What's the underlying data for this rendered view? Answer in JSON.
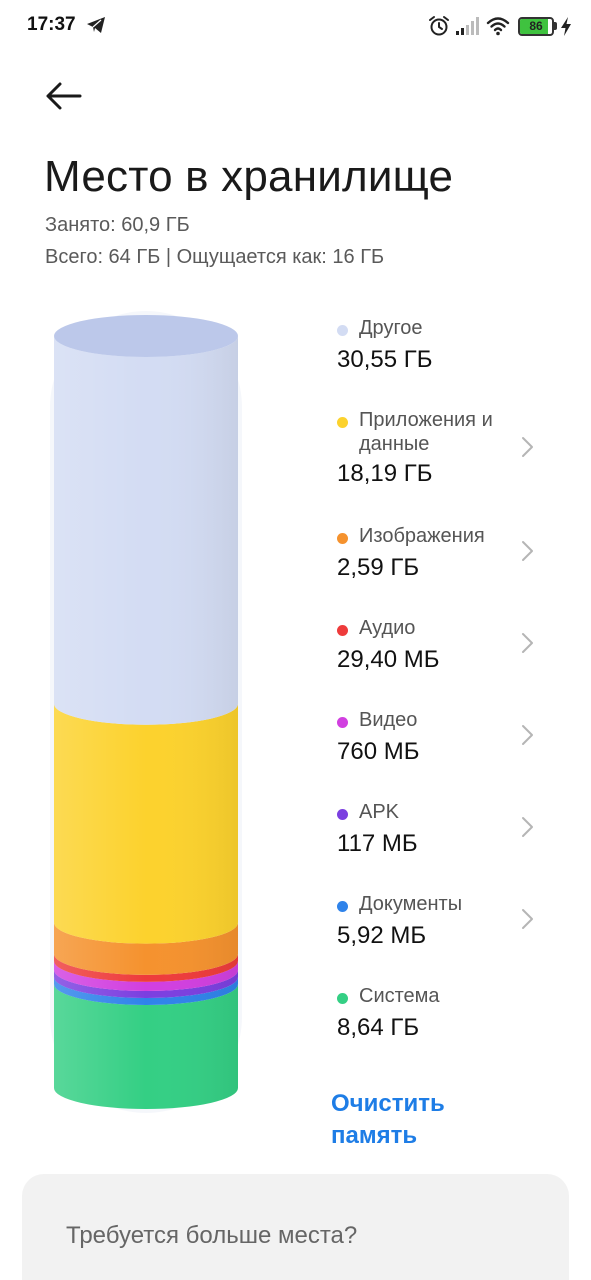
{
  "status_bar": {
    "time": "17:37",
    "battery_level": "86",
    "battery_fraction": 0.86,
    "icons": [
      "telegram-icon",
      "alarm-icon",
      "signal-icon",
      "wifi-icon",
      "battery-icon",
      "charging-icon"
    ]
  },
  "header": {
    "title": "Место в хранилище",
    "used": "Занято: 60,9 ГБ",
    "total": "Всего: 64 ГБ | Ощущается как: 16 ГБ"
  },
  "chart_data": {
    "type": "bar",
    "categories": [
      "Другое",
      "Приложения и данные",
      "Изображения",
      "Аудио",
      "Видео",
      "APK",
      "Документы",
      "Система"
    ],
    "values_gb": [
      30.55,
      18.19,
      2.59,
      0.0294,
      0.76,
      0.117,
      0.00592,
      8.64
    ]
  },
  "legend": [
    {
      "name": "Другое",
      "size": "30,55 ГБ",
      "color": "#d3dcf3",
      "chevron": false
    },
    {
      "name": "Приложения и данные",
      "size": "18,19 ГБ",
      "color": "#fcd22d",
      "chevron": true
    },
    {
      "name": "Изображения",
      "size": "2,59 ГБ",
      "color": "#f5922e",
      "chevron": true
    },
    {
      "name": "Аудио",
      "size": "29,40 МБ",
      "color": "#ee3b3b",
      "chevron": true
    },
    {
      "name": "Видео",
      "size": "760 МБ",
      "color": "#d13fe0",
      "chevron": true
    },
    {
      "name": "APK",
      "size": "117 МБ",
      "color": "#7b3fe0",
      "chevron": true
    },
    {
      "name": "Документы",
      "size": "5,92 МБ",
      "color": "#2f83ea",
      "chevron": true
    },
    {
      "name": "Система",
      "size": "8,64 ГБ",
      "color": "#34cf84",
      "chevron": false
    }
  ],
  "actions": {
    "clean": "Очистить память"
  },
  "more_card": {
    "text": "Требуется больше места?"
  }
}
